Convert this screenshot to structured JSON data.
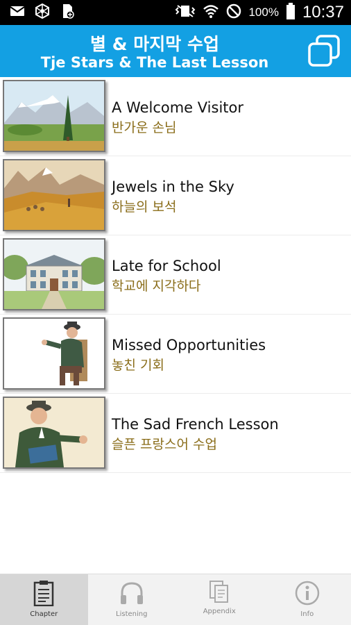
{
  "status_bar": {
    "battery_percent": "100%",
    "time": "10:37",
    "left_icons": [
      "mail-icon",
      "network-icon",
      "sd-card-icon"
    ],
    "right_icons": [
      "vibrate-icon",
      "wifi-icon",
      "blocked-icon",
      "battery-icon"
    ]
  },
  "header": {
    "title_ko": "별 & 마지막 수업",
    "title_en": "Tje Stars & The Last Lesson",
    "action_icon": "copy-icon",
    "color": "#13a0e3"
  },
  "chapters": [
    {
      "title_en": "A Welcome Visitor",
      "title_ko": "반가운 손님",
      "thumbnail": "mountain-landscape"
    },
    {
      "title_en": "Jewels in the Sky",
      "title_ko": "하늘의 보석",
      "thumbnail": "hillside-flock"
    },
    {
      "title_en": "Late for School",
      "title_ko": "학교에 지각하다",
      "thumbnail": "school-building"
    },
    {
      "title_en": "Missed Opportunities",
      "title_ko": "놓친 기회",
      "thumbnail": "seated-old-man"
    },
    {
      "title_en": "The Sad French Lesson",
      "title_ko": "슬픈 프랑스어 수업",
      "thumbnail": "teacher-with-book"
    }
  ],
  "bottom_nav": {
    "tabs": [
      {
        "label": "Chapter",
        "icon": "clipboard-icon",
        "active": true
      },
      {
        "label": "Listening",
        "icon": "headphones-icon",
        "active": false
      },
      {
        "label": "Appendix",
        "icon": "documents-icon",
        "active": false
      },
      {
        "label": "Info",
        "icon": "info-icon",
        "active": false
      }
    ]
  },
  "colors": {
    "accent": "#13a0e3",
    "korean_subtitle": "#8a6d1a"
  }
}
